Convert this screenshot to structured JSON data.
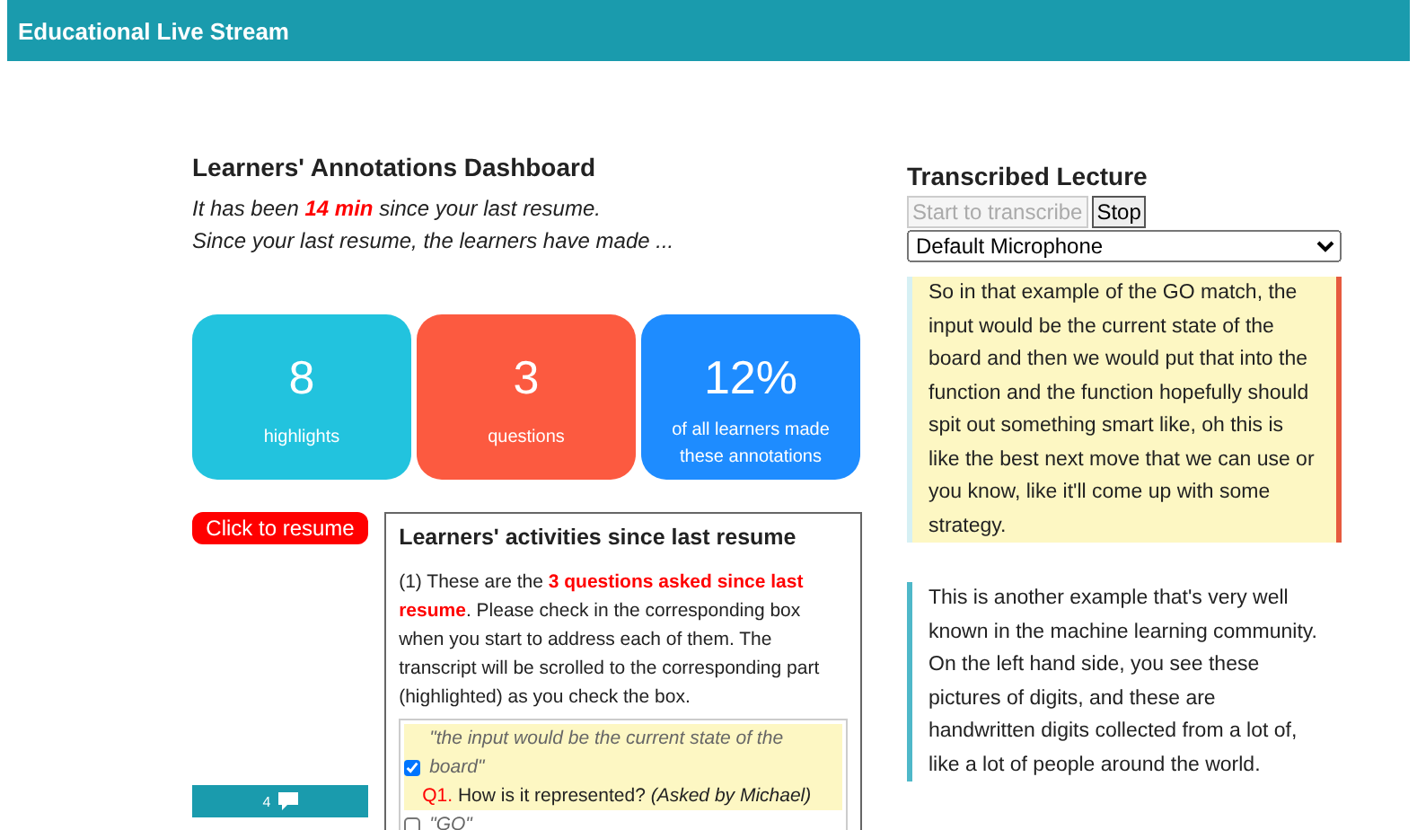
{
  "header": {
    "title": "Educational Live Stream"
  },
  "dashboard": {
    "title": "Learners' Annotations Dashboard",
    "elapsed": "It has been **14 min** since your last resume.",
    "summary": "Since your last resume, the learners have made ...",
    "stats": [
      {
        "value": "8",
        "label": "highlights",
        "color": "#22c3de"
      },
      {
        "value": "3",
        "label": "questions",
        "color": "#fc5a40"
      },
      {
        "value": "12%",
        "label": "of all learners made these annotations",
        "color": "#1e8cff"
      }
    ],
    "resume_button": "Click to resume",
    "comment_count": "4"
  },
  "activities": {
    "title": "Learners' activities since last resume",
    "intro_start": "(1) These are the ",
    "intro_emphasis": "3 questions asked since last resume",
    "intro_end": ". Please check in the corresponding box when you start to address each of them. The transcript will be scrolled to the corresponding part (highlighted) as you check the box.",
    "questions": [
      {
        "quote": "\"the input would be the current state of the board\"",
        "number": "Q1.",
        "text": "How is it represented?",
        "asker": "(Asked by Michael)",
        "checked": true,
        "highlighted": true
      },
      {
        "quote": "\"GO\"",
        "checked": false,
        "highlighted": false
      }
    ]
  },
  "lecture": {
    "title": "Transcribed Lecture",
    "start_button": {
      "label": "Start to transcribe",
      "disabled": true
    },
    "stop_button": {
      "label": "Stop",
      "disabled": false
    },
    "microphone": "Default Microphone",
    "segments": [
      {
        "text": "So in that example of the GO match, the input would be the current state of the board and then we would put that into the function and the function hopefully should spit out something smart like, oh this is like the best next move that we can use or you know, like it'll come up with some strategy.",
        "highlighted": true
      },
      {
        "text": "This is another example that's very well known in the machine learning community. On the left hand side, you see these pictures of digits, and these are handwritten digits collected from a lot of, like a lot of people around the world.",
        "highlighted": false
      }
    ]
  }
}
